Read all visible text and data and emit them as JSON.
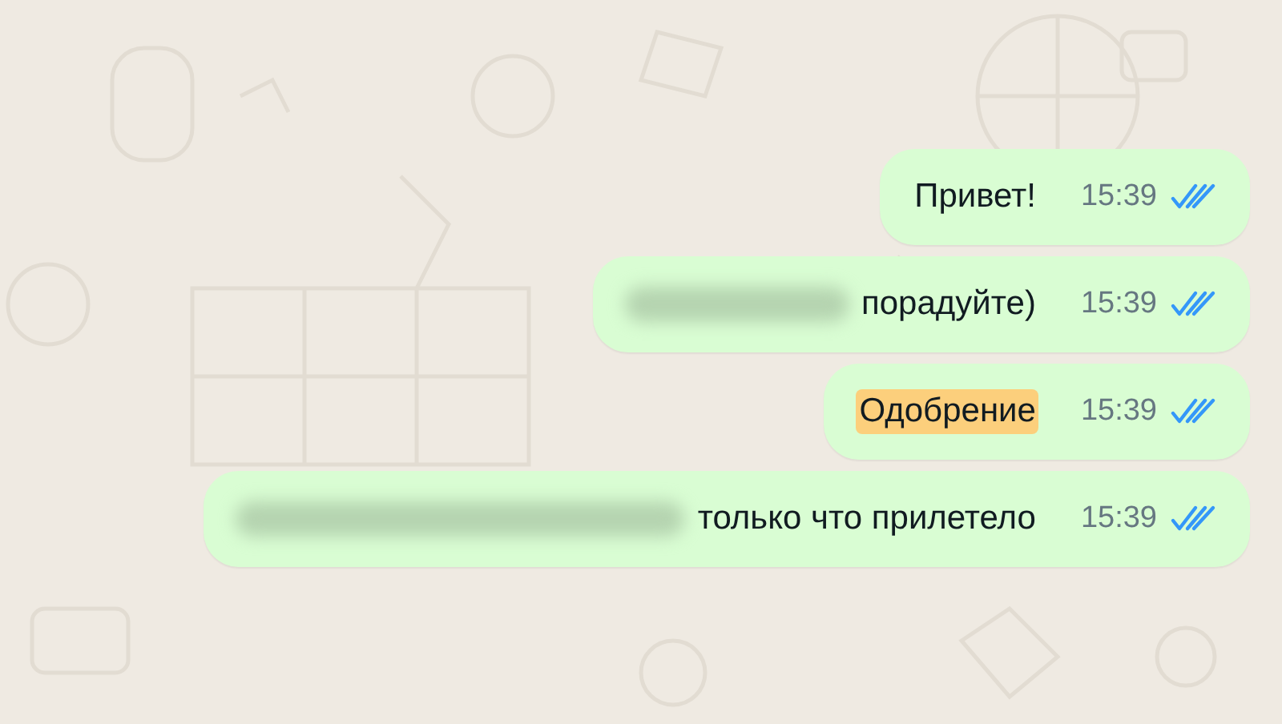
{
  "messages": [
    {
      "text": "Привет!",
      "time": "15:39",
      "read": true,
      "highlighted": false,
      "redacted": false
    },
    {
      "text": "порадуйте)",
      "time": "15:39",
      "read": true,
      "highlighted": false,
      "redacted": true
    },
    {
      "text": "Одобрение",
      "time": "15:39",
      "read": true,
      "highlighted": true,
      "redacted": false
    },
    {
      "text": "только что прилетело",
      "time": "15:39",
      "read": true,
      "highlighted": false,
      "redacted": true
    }
  ]
}
